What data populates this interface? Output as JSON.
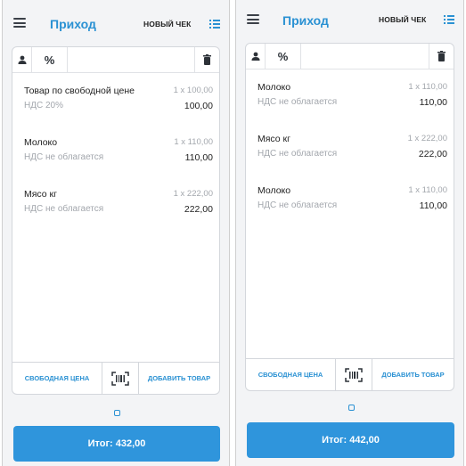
{
  "colors": {
    "accent": "#2a91d3",
    "total_button": "#2f95dc",
    "background": "#f3f4f6"
  },
  "screens": [
    {
      "title": "Приход",
      "new_check": "НОВЫЙ ЧЕК",
      "items": [
        {
          "name": "Товар по свободной цене",
          "qty": "1 x 100,00",
          "tax": "НДС 20%",
          "sum": "100,00"
        },
        {
          "name": "Молоко",
          "qty": "1 x 110,00",
          "tax": "НДС не облагается",
          "sum": "110,00"
        },
        {
          "name": "Мясо кг",
          "qty": "1 x 222,00",
          "tax": "НДС не облагается",
          "sum": "222,00"
        }
      ],
      "free_price_label": "СВОБОДНАЯ ЦЕНА",
      "add_item_label": "ДОБАВИТЬ ТОВАР",
      "total_label": "Итог: 432,00"
    },
    {
      "title": "Приход",
      "new_check": "НОВЫЙ ЧЕК",
      "items": [
        {
          "name": "Молоко",
          "qty": "1 x 110,00",
          "tax": "НДС не облагается",
          "sum": "110,00"
        },
        {
          "name": "Мясо кг",
          "qty": "1 x 222,00",
          "tax": "НДС не облагается",
          "sum": "222,00"
        },
        {
          "name": "Молоко",
          "qty": "1 x 110,00",
          "tax": "НДС не облагается",
          "sum": "110,00"
        }
      ],
      "free_price_label": "СВОБОДНАЯ ЦЕНА",
      "add_item_label": "ДОБАВИТЬ ТОВАР",
      "total_label": "Итог: 442,00"
    }
  ],
  "icons": [
    "menu-icon",
    "list-icon",
    "user-icon",
    "percent-icon",
    "trash-icon",
    "barcode-icon"
  ]
}
